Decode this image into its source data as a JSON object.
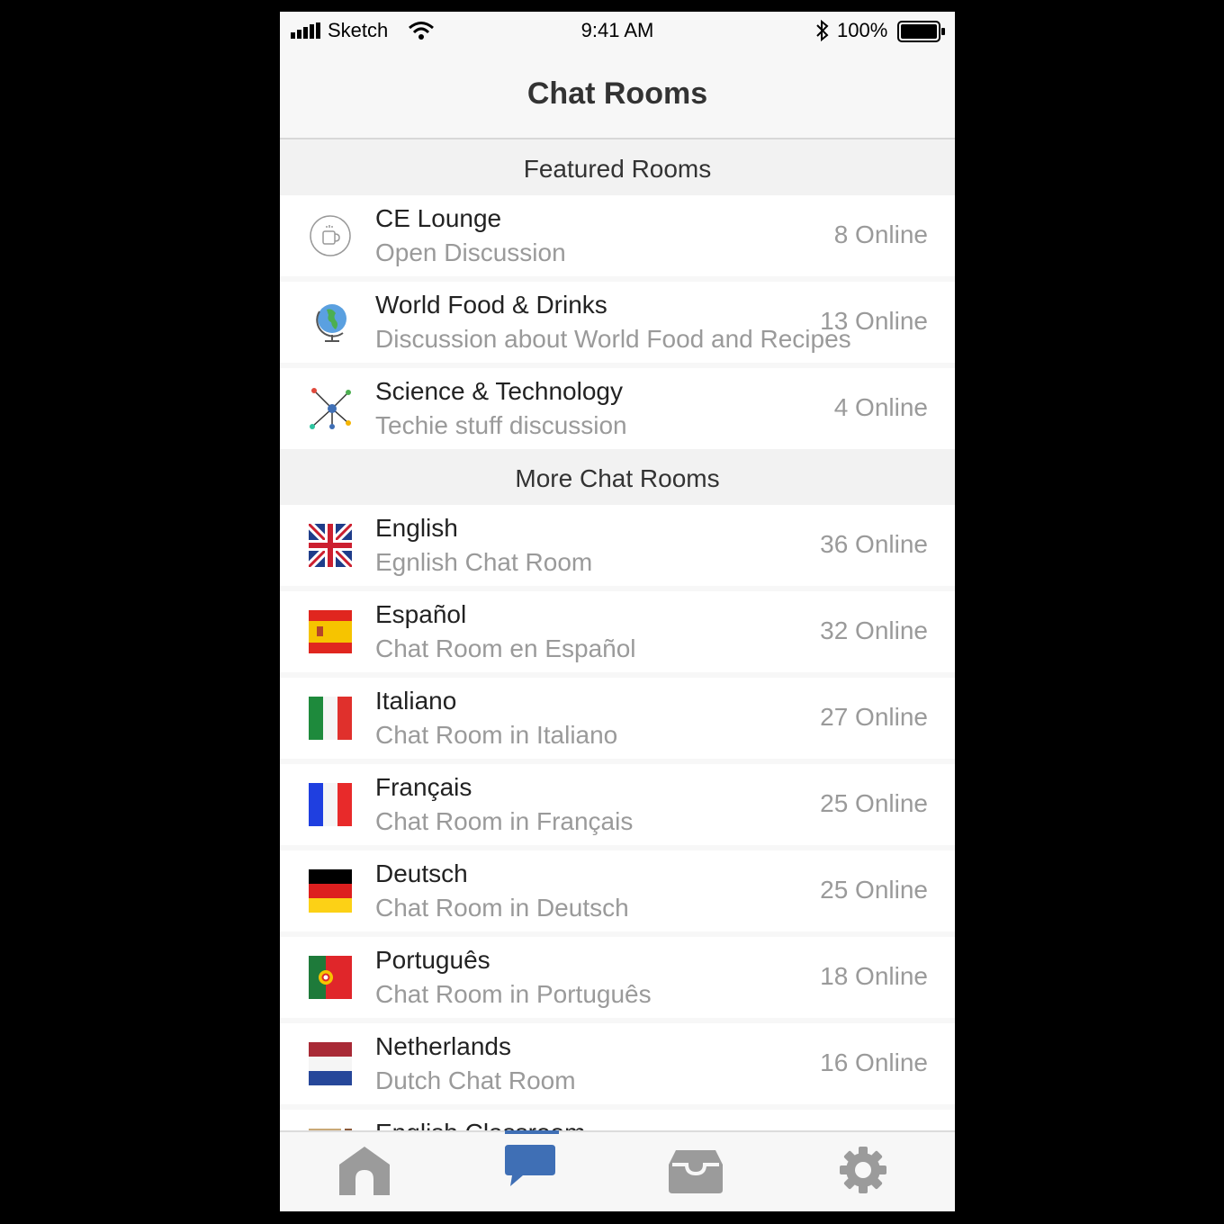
{
  "status_bar": {
    "carrier": "Sketch",
    "time": "9:41 AM",
    "battery_percent": "100%"
  },
  "nav": {
    "title": "Chat Rooms"
  },
  "sections": [
    {
      "header": "Featured Rooms",
      "rooms": [
        {
          "name": "CE Lounge",
          "description": "Open Discussion",
          "online": "8 Online",
          "icon": "coffee-cup-icon"
        },
        {
          "name": "World Food & Drinks",
          "description": "Discussion about World Food and Recipes",
          "online": "13 Online",
          "icon": "globe-icon"
        },
        {
          "name": "Science & Technology",
          "description": "Techie stuff discussion",
          "online": "4 Online",
          "icon": "network-nodes-icon"
        }
      ]
    },
    {
      "header": "More Chat Rooms",
      "rooms": [
        {
          "name": "English",
          "description": "Egnlish Chat Room",
          "online": "36 Online",
          "icon": "uk-flag-icon"
        },
        {
          "name": "Español",
          "description": "Chat Room en Español",
          "online": "32 Online",
          "icon": "spain-flag-icon"
        },
        {
          "name": "Italiano",
          "description": "Chat Room in Italiano",
          "online": "27 Online",
          "icon": "italy-flag-icon"
        },
        {
          "name": "Français",
          "description": "Chat Room in Français",
          "online": "25 Online",
          "icon": "france-flag-icon"
        },
        {
          "name": "Deutsch",
          "description": "Chat Room in Deutsch",
          "online": "25 Online",
          "icon": "germany-flag-icon"
        },
        {
          "name": "Português",
          "description": "Chat Room in Português",
          "online": "18 Online",
          "icon": "portugal-flag-icon"
        },
        {
          "name": "Netherlands",
          "description": "Dutch Chat Room",
          "online": "16 Online",
          "icon": "netherlands-flag-icon"
        },
        {
          "name": "English Classroom",
          "description": "",
          "online": "",
          "icon": "classroom-icon"
        }
      ]
    }
  ],
  "tab_bar": {
    "tabs": [
      {
        "icon": "home-icon",
        "active": false
      },
      {
        "icon": "chat-bubble-icon",
        "active": true
      },
      {
        "icon": "inbox-icon",
        "active": false
      },
      {
        "icon": "gear-icon",
        "active": false
      }
    ]
  },
  "colors": {
    "accent": "#3f6fb5",
    "inactive_icon": "#9b9b9b",
    "subtitle_gray": "#9a9a9a"
  }
}
